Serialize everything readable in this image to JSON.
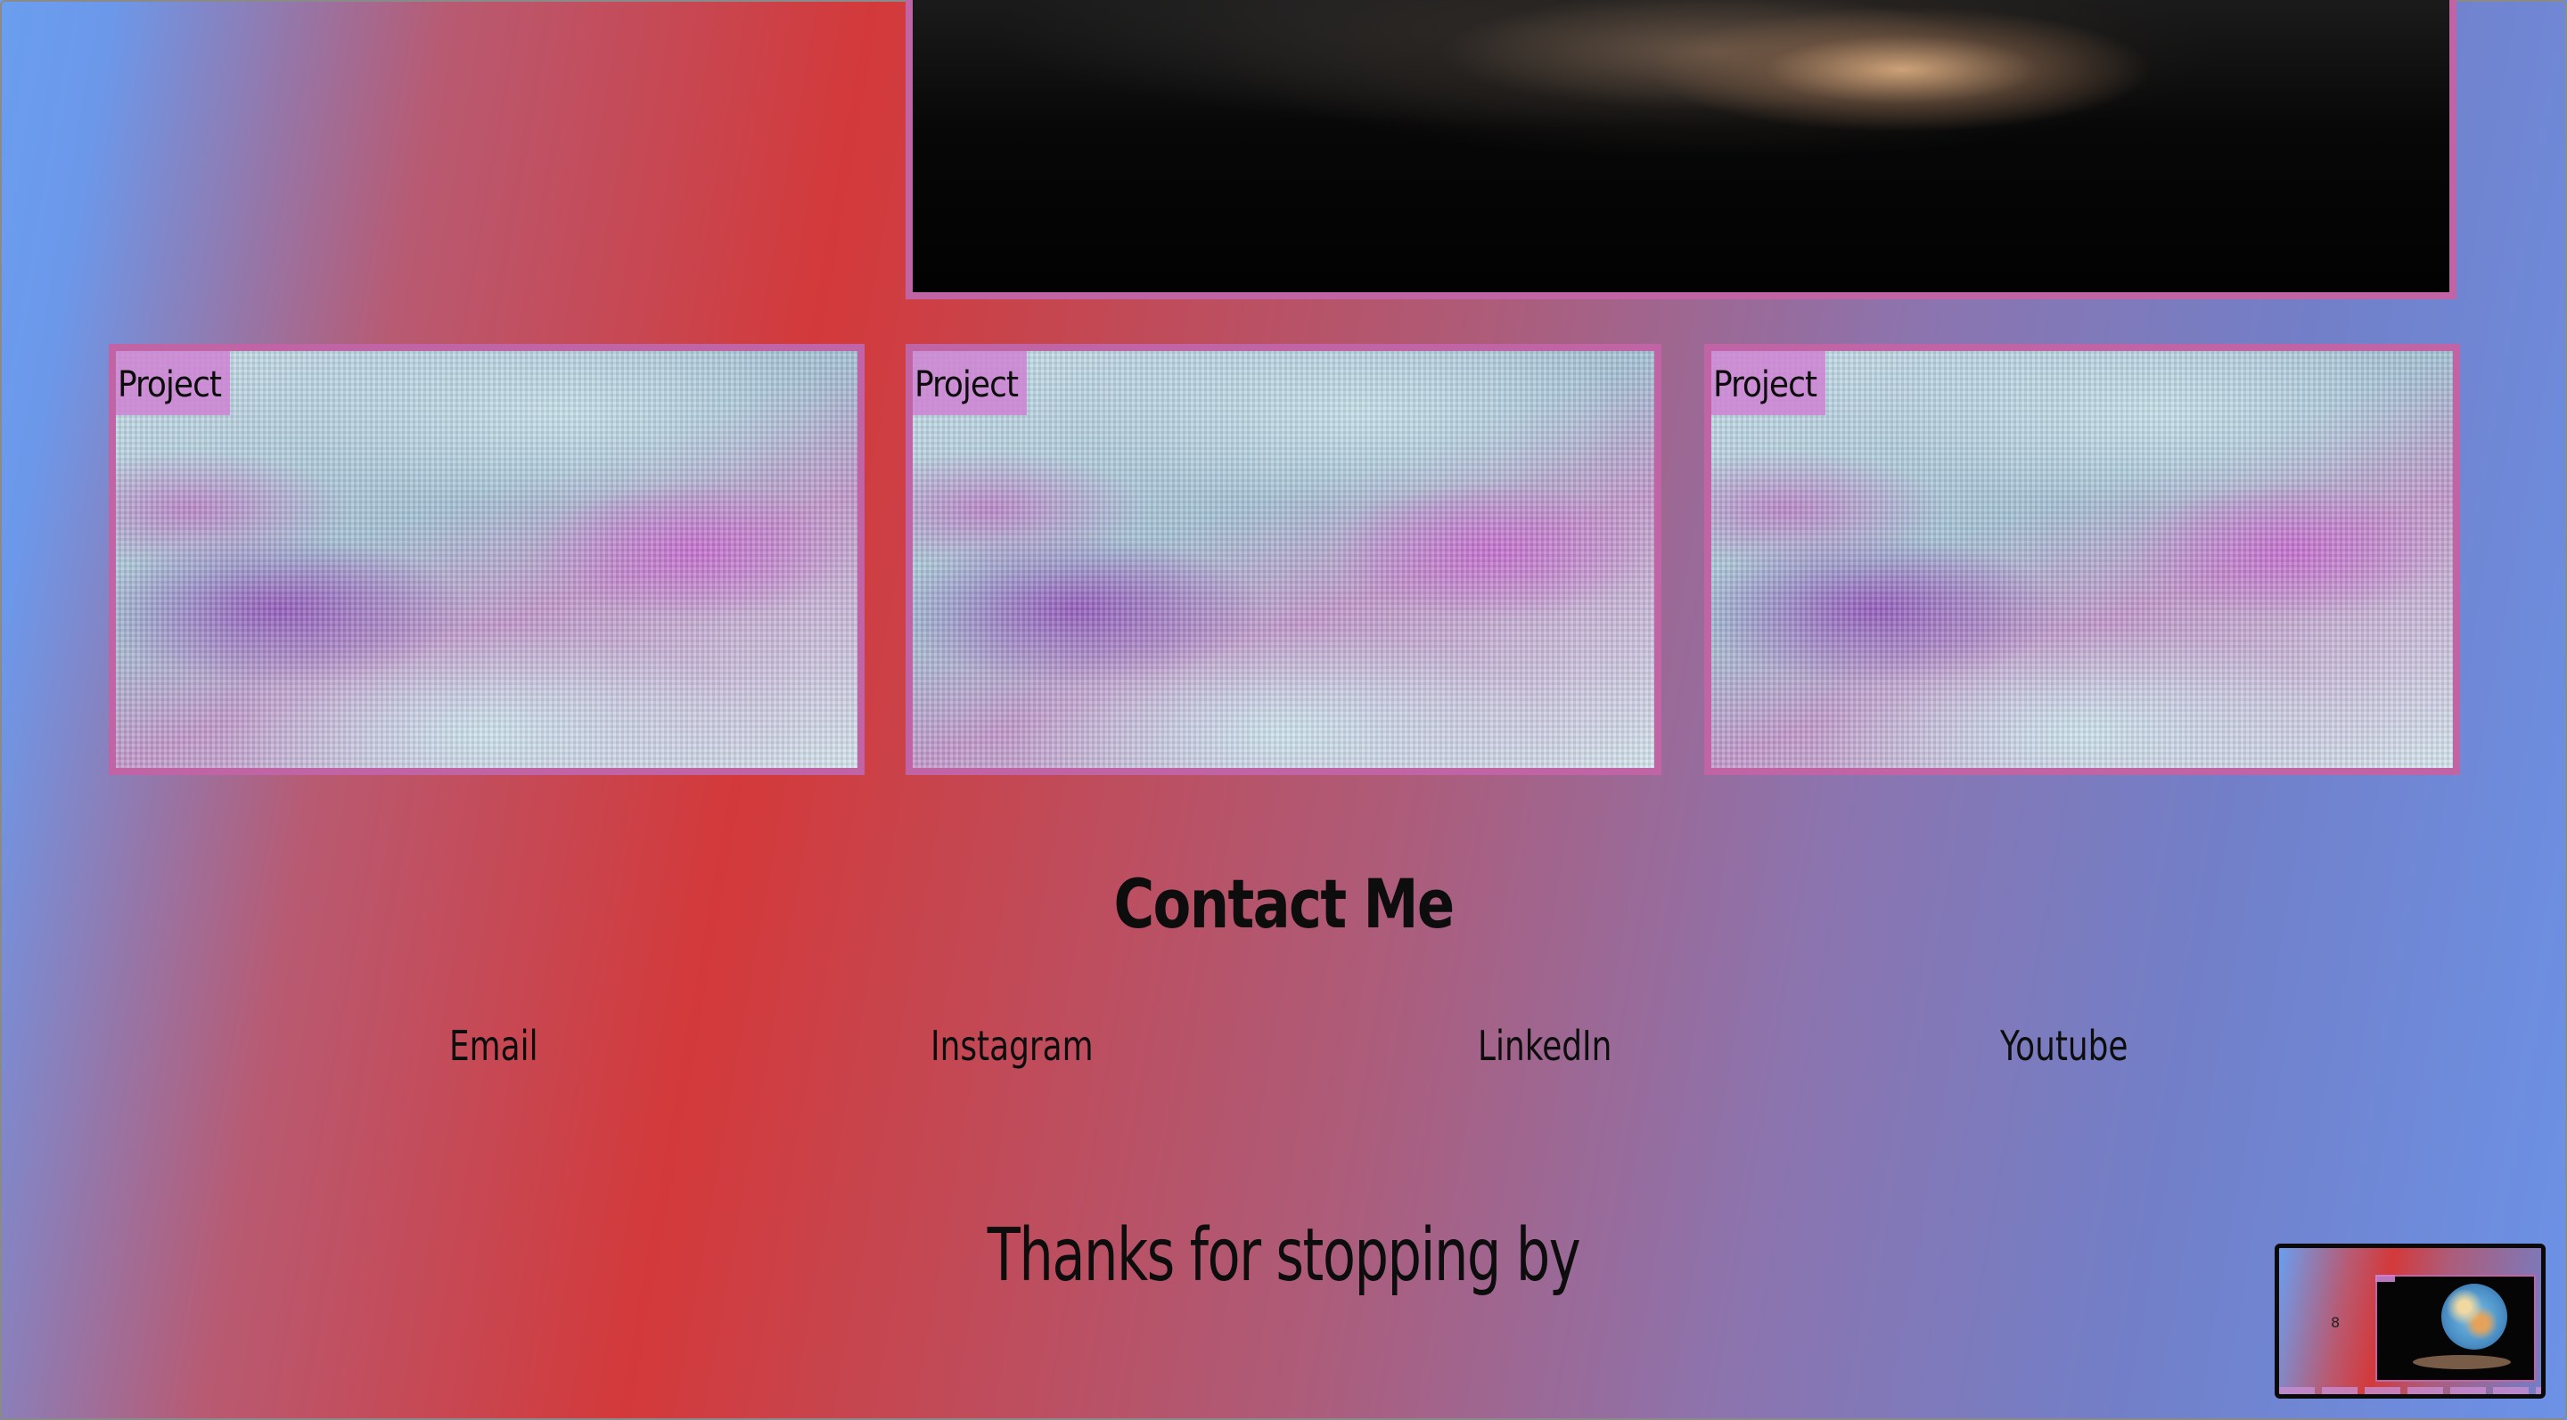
{
  "projects": [
    {
      "label": "Project"
    },
    {
      "label": "Project"
    },
    {
      "label": "Project"
    }
  ],
  "contact": {
    "title": "Contact Me",
    "links": [
      "Email",
      "Instagram",
      "LinkedIn",
      "Youtube"
    ]
  },
  "footer": {
    "thanks": "Thanks for stopping by"
  },
  "minimap": {
    "glyph": "8"
  },
  "colors": {
    "card_border": "#c064a6",
    "label_bg": "#ce82d2",
    "text": "#0d0d0d",
    "gradient_blue": "#6a9eef",
    "gradient_red": "#d3393a"
  }
}
